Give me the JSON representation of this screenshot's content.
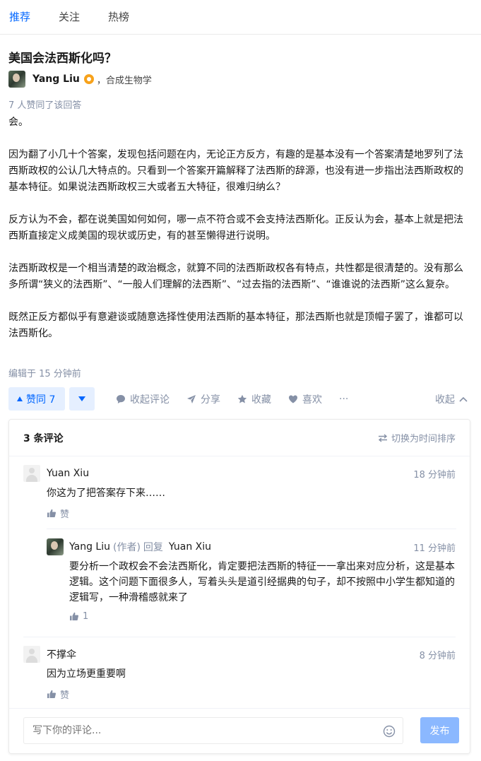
{
  "nav": {
    "tabs": [
      {
        "label": "推荐",
        "active": true
      },
      {
        "label": "关注"
      },
      {
        "label": "热榜"
      }
    ]
  },
  "question": {
    "title": "美国会法西斯化吗？"
  },
  "author": {
    "name": "Yang Liu",
    "headline": "，合成生物学"
  },
  "answer": {
    "votes_text": "7 人赞同了该回答",
    "paragraphs": [
      "会。",
      "因为翻了小几十个答案，发现包括问题在内，无论正方反方，有趣的是基本没有一个答案清楚地罗列了法西斯政权的公认几大特点的。只看到一个答案开篇解释了法西斯的辞源，也没有进一步指出法西斯政权的基本特征。如果说法西斯政权三大或者五大特征，很难归纳么？",
      "反方认为不会，都在说美国如何如何，哪一点不符合或不会支持法西斯化。正反认为会，基本上就是把法西斯直接定义成美国的现状或历史，有的甚至懒得进行说明。",
      "法西斯政权是一个相当清楚的政治概念，就算不同的法西斯政权各有特点，共性都是很清楚的。没有那么多所谓“狭义的法西斯”、“一般人们理解的法西斯”、“过去指的法西斯”、“谁谁说的法西斯”这么复杂。",
      "既然正反方都似乎有意避谈或随意选择性使用法西斯的基本特征，那法西斯也就是顶帽子罢了，谁都可以法西斯化。"
    ],
    "edited": "编辑于 15 分钟前"
  },
  "actions": {
    "upvote": "赞同 7",
    "comment": "收起评论",
    "share": "分享",
    "favorite": "收藏",
    "like": "喜欢",
    "more": "···",
    "collapse": "收起"
  },
  "comments": {
    "count": "3 条评论",
    "sort": "切换为时间排序",
    "items": [
      {
        "author": "Yuan Xiu",
        "time": "18 分钟前",
        "text": "你这为了把答案存下来……",
        "like": "赞"
      },
      {
        "author": "Yang Liu",
        "tag": "(作者)",
        "reply": "回复",
        "target": "Yuan Xiu",
        "time": "11 分钟前",
        "text": "要分析一个政权会不会法西斯化，肯定要把法西斯的特征一一拿出来对应分析，这是基本逻辑。这个问题下面很多人，写着头头是道引经据典的句子，却不按照中小学生都知道的逻辑写，一种滑稽感就来了",
        "like": "1"
      },
      {
        "author": "不撑伞",
        "time": "8 分钟前",
        "text": "因为立场更重要啊",
        "like": "赞"
      }
    ],
    "input_placeholder": "写下你的评论...",
    "submit": "发布"
  },
  "colors": {
    "accent": "#0066ff",
    "muted": "#8590a6",
    "upvote_bg": "#e5efff",
    "submit_bg": "#8bb8ff"
  }
}
